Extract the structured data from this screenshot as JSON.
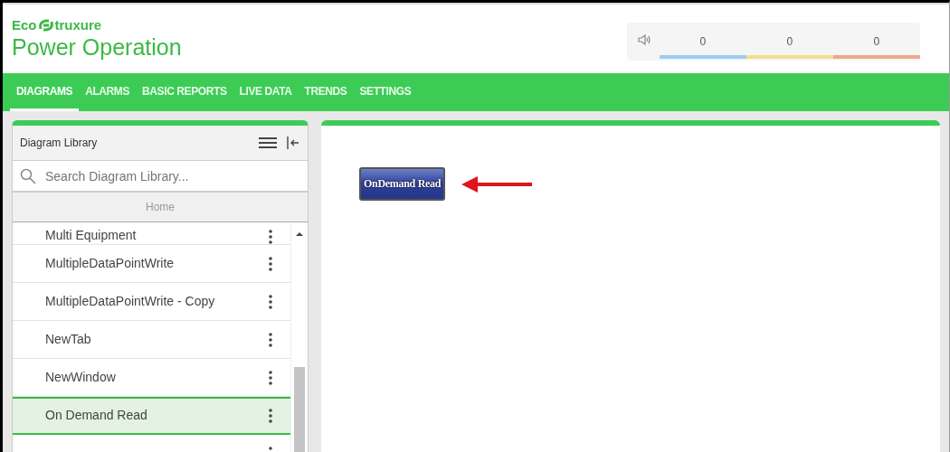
{
  "brand": {
    "logo_left": "Eco",
    "logo_right": "truxure",
    "product": "Power Operation"
  },
  "alarm_counters": [
    {
      "count": "0",
      "color": "#9ccdf2"
    },
    {
      "count": "0",
      "color": "#f2e08c"
    },
    {
      "count": "0",
      "color": "#f0a68c"
    }
  ],
  "nav_tabs": [
    {
      "label": "DIAGRAMS",
      "selected": true
    },
    {
      "label": "ALARMS",
      "selected": false
    },
    {
      "label": "BASIC REPORTS",
      "selected": false
    },
    {
      "label": "LIVE DATA",
      "selected": false
    },
    {
      "label": "TRENDS",
      "selected": false
    },
    {
      "label": "SETTINGS",
      "selected": false
    }
  ],
  "library": {
    "title": "Diagram Library",
    "search_placeholder": "Search Diagram Library...",
    "breadcrumb": "Home",
    "items": [
      {
        "label": "Multi Equipment",
        "selected": false
      },
      {
        "label": "MultipleDataPointWrite",
        "selected": false
      },
      {
        "label": "MultipleDataPointWrite - Copy",
        "selected": false
      },
      {
        "label": "NewTab",
        "selected": false
      },
      {
        "label": "NewWindow",
        "selected": false
      },
      {
        "label": "On Demand Read",
        "selected": true
      },
      {
        "selected": false
      }
    ]
  },
  "diagram": {
    "button": "OnDemand Read"
  }
}
